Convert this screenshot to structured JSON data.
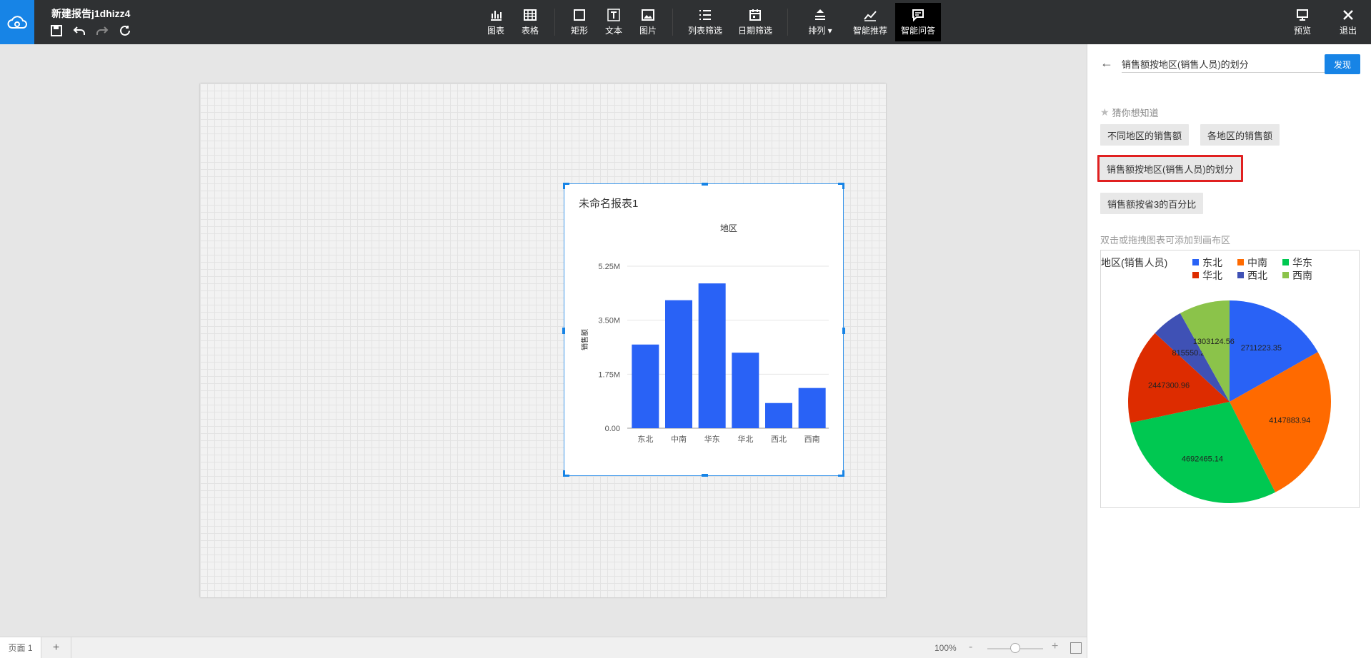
{
  "header": {
    "report_title": "新建报告j1dhizz4",
    "tools": [
      {
        "label": "图表",
        "icon": "bar-chart-icon"
      },
      {
        "label": "表格",
        "icon": "table-icon"
      },
      {
        "label": "矩形",
        "icon": "rectangle-icon"
      },
      {
        "label": "文本",
        "icon": "text-icon"
      },
      {
        "label": "图片",
        "icon": "image-icon"
      },
      {
        "label": "列表筛选",
        "icon": "list-filter-icon"
      },
      {
        "label": "日期筛选",
        "icon": "calendar-icon"
      },
      {
        "label": "排列",
        "icon": "arrange-icon"
      },
      {
        "label": "智能推荐",
        "icon": "trend-icon"
      },
      {
        "label": "智能问答",
        "icon": "chat-icon"
      }
    ],
    "preview_label": "预览",
    "exit_label": "退出"
  },
  "canvas": {
    "widget_title": "未命名报表1",
    "accent_color": "#2962f6"
  },
  "chart_data": [
    {
      "type": "bar",
      "title": "地区",
      "ylabel": "销售额",
      "categories": [
        "东北",
        "中南",
        "华东",
        "华北",
        "西北",
        "西南"
      ],
      "values": [
        2711223.35,
        4147883.94,
        4692465.14,
        2447300.96,
        815550.21,
        1303124.56
      ],
      "yticks": [
        "0.00",
        "1.75M",
        "3.50M",
        "5.25M"
      ],
      "ylim": [
        0,
        5250000
      ],
      "grid": true,
      "color": "#2962f6"
    },
    {
      "type": "pie",
      "legend_title": "地区(销售人员)",
      "categories": [
        "东北",
        "中南",
        "华东",
        "华北",
        "西北",
        "西南"
      ],
      "values": [
        2711223.35,
        4147883.94,
        4692465.14,
        2447300.96,
        815550.21,
        1303124.56
      ],
      "labels": [
        "2711223.35",
        "4147883.94",
        "4692465.14",
        "2447300.96",
        "815550.21",
        "1303124.56"
      ],
      "colors": [
        "#2962f6",
        "#ff6a00",
        "#00c851",
        "#dd2c00",
        "#3f51b5",
        "#8bc34a"
      ],
      "legend_placement": "top"
    }
  ],
  "panel": {
    "query_text": "销售额按地区(销售人员)的划分",
    "discover_label": "发现",
    "guess_label": "猜你想知道",
    "suggestions": [
      "不同地区的销售额",
      "各地区的销售额",
      "销售额按地区(销售人员)的划分",
      "销售额按省3的百分比"
    ],
    "hint": "双击或拖拽图表可添加到画布区"
  },
  "footer": {
    "page_tab": "页面 1",
    "add_page": "+",
    "zoom": "100%",
    "zoom_minus": "-",
    "zoom_plus": "+"
  }
}
